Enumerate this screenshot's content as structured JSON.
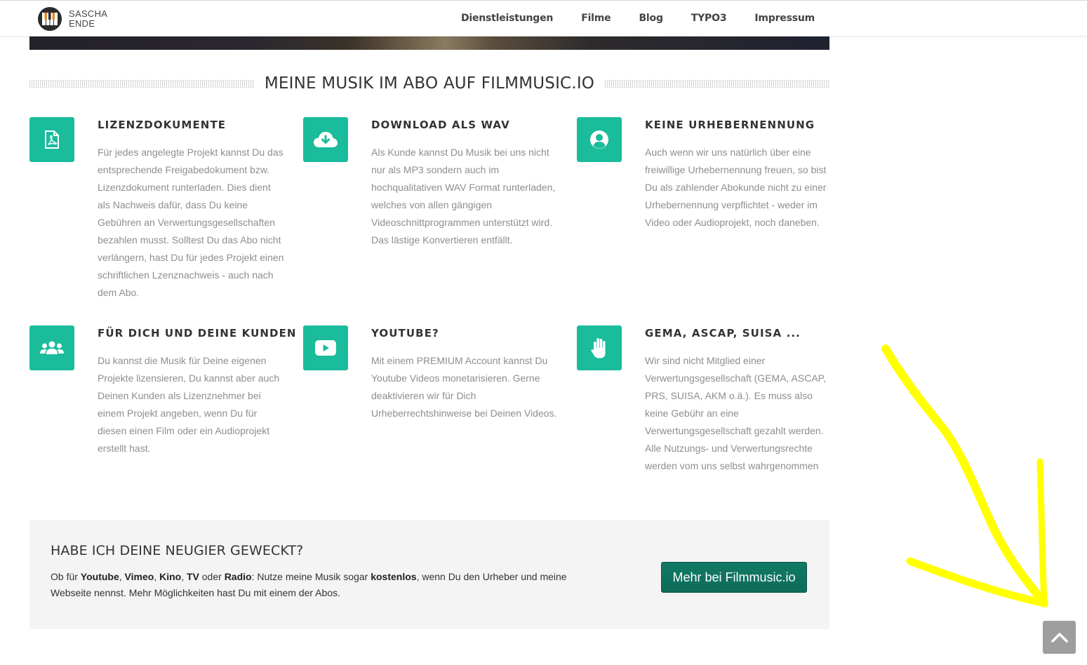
{
  "header": {
    "logo_line1": "SASCHA",
    "logo_line2": "ENDE",
    "nav": [
      "Dienstleistungen",
      "Filme",
      "Blog",
      "TYPO3",
      "Impressum"
    ]
  },
  "section": {
    "title": "MEINE MUSIK IM ABO AUF FILMMUSIC.IO"
  },
  "features": [
    {
      "icon": "pdf-file-icon",
      "title": "LIZENZDOKUMENTE",
      "text": "Für jedes angelegte Projekt kannst Du das entsprechende Freigabedokument bzw. Lizenzdokument runterladen. Dies dient als Nachweis dafür, dass Du keine Gebühren an Verwertungsgesellschaften bezahlen musst. Solltest Du das Abo nicht verlängern, hast Du für jedes Projekt einen schriftlichen Lzenznachweis - auch nach dem Abo."
    },
    {
      "icon": "cloud-download-icon",
      "title": "DOWNLOAD ALS WAV",
      "text": "Als Kunde kannst Du Musik bei uns nicht nur als MP3 sondern auch im hochqualitativen WAV Format runterladen, welches von allen gängigen Videoschnittprogrammen unterstützt wird. Das lästige Konvertieren entfällt."
    },
    {
      "icon": "user-circle-icon",
      "title": "KEINE URHEBERNENNUNG",
      "text": "Auch wenn wir uns natürlich über eine freiwillige Urhebernennung freuen, so bist Du als zahlender Abokunde nicht zu einer Urhebernennung verpflichtet - weder im Video oder Audioprojekt, noch daneben."
    },
    {
      "icon": "users-icon",
      "title": "FÜR DICH UND DEINE KUNDEN",
      "text": "Du kannst die Musik für Deine eigenen Projekte lizensieren, Du kannst aber auch Deinen Kunden als Lizenznehmer bei einem Projekt angeben, wenn Du für diesen einen Film oder ein Audioprojekt erstellt hast."
    },
    {
      "icon": "youtube-icon",
      "title": "YOUTUBE?",
      "text": "Mit einem PREMIUM Account kannst Du Youtube Videos monetarisieren. Gerne deaktivieren wir für Dich Urheberrechtshinweise bei Deinen Videos."
    },
    {
      "icon": "hand-stop-icon",
      "title": "GEMA, ASCAP, SUISA ...",
      "text": "Wir sind nicht Mitglied einer Verwertungsgesellschaft (GEMA, ASCAP, PRS, SUISA, AKM o.ä.). Es muss also keine Gebühr an eine Verwertungsgesellschaft gezahlt werden. Alle Nutzungs- und Verwertungsrechte werden vom uns selbst wahrgenommen"
    }
  ],
  "cta": {
    "title": "HABE ICH DEINE NEUGIER GEWECKT?",
    "t1": "Ob für ",
    "b1": "Youtube",
    "t2": ", ",
    "b2": "Vimeo",
    "t3": ", ",
    "b3": "Kino",
    "t4": ", ",
    "b4": "TV",
    "t5": " oder ",
    "b5": "Radio",
    "t6": ": Nutze meine Musik sogar ",
    "b6": "kostenlos",
    "t7": ", wenn Du den Urheber und meine Webseite nennst. Mehr Möglichkeiten hast Du mit einem der Abos.",
    "button": "Mehr bei Filmmusic.io"
  },
  "colors": {
    "accent": "#1abc9c",
    "button": "#117a65",
    "annotation": "#ffff00"
  }
}
